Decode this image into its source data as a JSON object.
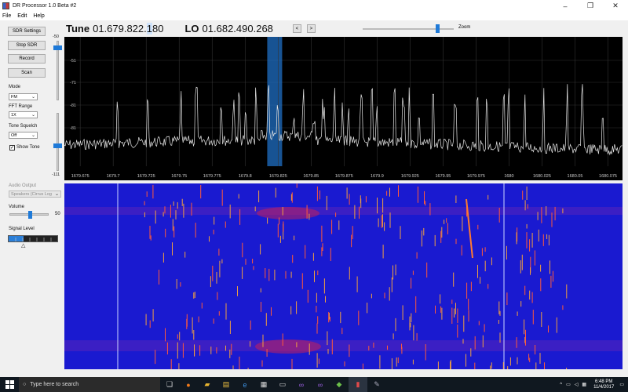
{
  "window": {
    "title": "DR Processor 1.0 Beta #2",
    "min_label": "–",
    "max_label": "❐",
    "close_label": "✕"
  },
  "menu": [
    "File",
    "Edit",
    "Help"
  ],
  "sidebar": {
    "buttons": [
      "SDR Settings",
      "Stop SDR",
      "Record",
      "Scan"
    ],
    "mode_label": "Mode",
    "mode_value": "FM",
    "fft_label": "FFT Range",
    "fft_value": "1X",
    "squelch_label": "Tone Squelch",
    "squelch_value": "Off",
    "show_tone_label": "Show Tone",
    "show_tone_checked": true,
    "scale_top": "-50",
    "scale_bottom": "-111",
    "audio_output_label": "Audio Output",
    "audio_output_value": "Speakers (Cirrus Log",
    "volume_label": "Volume",
    "volume_value": "50",
    "signal_label": "Signal Level",
    "signal_level": 0.3
  },
  "tuner": {
    "tune_label": "Tune",
    "tune_value_a": "01.679.822.",
    "tune_value_sel": "1",
    "tune_value_b": "80",
    "lo_label": "LO",
    "lo_value": "01.682.490.268",
    "prev_label": "<",
    "next_label": ">",
    "zoom_label": "Zoom",
    "zoom_level": 0.82
  },
  "spectrum": {
    "y_ticks": [
      "-51",
      "-71",
      "-81",
      "-81"
    ],
    "x_ticks": [
      "1679.675",
      "1679.7",
      "1679.725",
      "1679.75",
      "1679.775",
      "1679.8",
      "1679.825",
      "1679.85",
      "1679.875",
      "1679.9",
      "1679.925",
      "1679.95",
      "1679.975",
      "1680",
      "1680.025",
      "1680.05",
      "1680.075"
    ],
    "tune_mhz": 1679.8221,
    "x_min": 1679.663,
    "x_max": 1680.086
  },
  "taskbar": {
    "search_placeholder": "Type here to search",
    "time": "6:48 PM",
    "date": "11/4/2017"
  },
  "colors": {
    "accent": "#1f7ad8",
    "spectrum_bg": "#000000",
    "waterfall_bg": "#1a1ad0",
    "tune_band": "#1f6fc4"
  }
}
